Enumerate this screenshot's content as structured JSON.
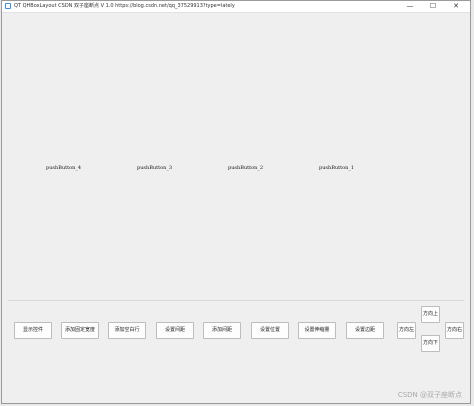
{
  "window": {
    "title": "QT QHBoxLayout  CSDN 双子座断点 V 1.0 https://blog.csdn.net/qq_37529913?type=lately",
    "controls": {
      "minimize": "—",
      "maximize": "☐",
      "close": "✕"
    }
  },
  "top_buttons": [
    "pushButton_4",
    "pushButton_3",
    "pushButton_2",
    "pushButton_1"
  ],
  "bottom_buttons": [
    "显示控件",
    "添加固定宽度",
    "添加空白行",
    "设置间距",
    "添加间距",
    "设置位置",
    "设置伸缩量",
    "设置边距"
  ],
  "direction_buttons": {
    "left": "方向左",
    "up": "方向上",
    "down": "方向下",
    "right": "方向右"
  },
  "watermark": "CSDN @双子座断点"
}
